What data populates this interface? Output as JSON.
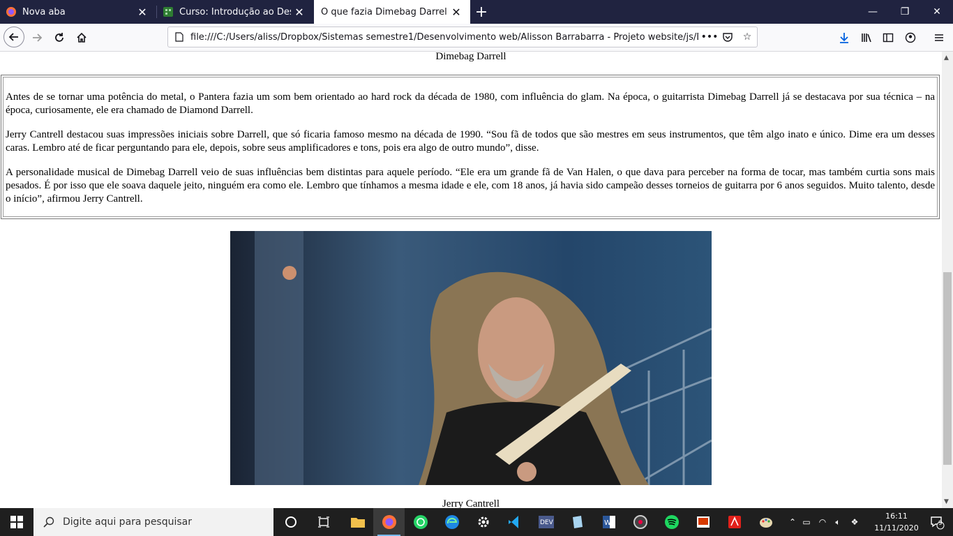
{
  "browser": {
    "tabs": [
      {
        "label": "Nova aba",
        "icon": "firefox-icon",
        "active": false
      },
      {
        "label": "Curso: Introdução ao Desenvolvimento Web",
        "icon": "course-icon",
        "active": false
      },
      {
        "label": "O que fazia Dimebag Darrell ser único",
        "icon": "none",
        "active": true
      }
    ],
    "url": "file:///C:/Users/aliss/Dropbox/Sistemas semestre1/Desenvolvimento web/Alisson Barrabarra - Projeto website/js/Dimebag"
  },
  "page": {
    "top_caption": "Dimebag Darrell",
    "paragraphs": [
      "Antes de se tornar uma potência do metal, o Pantera fazia um som bem orientado ao hard rock da década de 1980, com influência do glam. Na época, o guitarrista Dimebag Darrell já se destacava por sua técnica – na época, curiosamente, ele era chamado de Diamond Darrell.",
      "Jerry Cantrell destacou suas impressões iniciais sobre Darrell, que só ficaria famoso mesmo na década de 1990. “Sou fã de todos que são mestres em seus instrumentos, que têm algo inato e único. Dime era um desses caras. Lembro até de ficar perguntando para ele, depois, sobre seus amplificadores e tons, pois era algo de outro mundo”, disse.",
      "A personalidade musical de Dimebag Darrell veio de suas influências bem distintas para aquele período. “Ele era um grande fã de Van Halen, o que dava para perceber na forma de tocar, mas também curtia sons mais pesados. É por isso que ele soava daquele jeito, ninguém era como ele. Lembro que tínhamos a mesma idade e ele, com 18 anos, já havia sido campeão desses torneios de guitarra por 6 anos seguidos. Muito talento, desde o início”, afirmou Jerry Cantrell."
    ],
    "photo_caption": "Jerry Cantrell"
  },
  "taskbar": {
    "search_placeholder": "Digite aqui para pesquisar",
    "time": "16:11",
    "date": "11/11/2020",
    "notification_count": "9"
  }
}
